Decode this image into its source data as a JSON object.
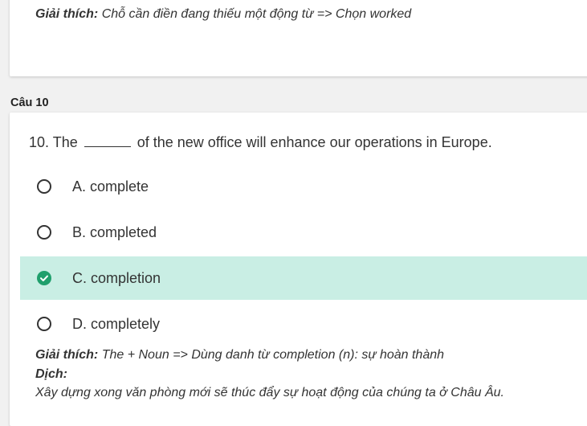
{
  "previous": {
    "explanation_label": "Giải thích:",
    "explanation_text": "Chỗ cần điền đang thiếu một động từ => Chọn worked"
  },
  "question": {
    "title": "Câu 10",
    "text_before": "10. The",
    "text_after": "of the new office will enhance our operations in Europe.",
    "options": [
      {
        "label": "A. complete",
        "selected": false
      },
      {
        "label": "B. completed",
        "selected": false
      },
      {
        "label": "C. completion",
        "selected": true
      },
      {
        "label": "D. completely",
        "selected": false
      }
    ],
    "explanation_label": "Giải thích:",
    "explanation_text": "The + Noun => Dùng danh từ completion (n): sự hoàn thành",
    "translation_label": "Dịch:",
    "translation_text": "Xây dựng xong văn phòng mới sẽ thúc đẩy sự hoạt động của chúng ta ở Châu Âu."
  },
  "colors": {
    "selected_bg": "#c9eee4",
    "check_green": "#1f9f6c"
  }
}
